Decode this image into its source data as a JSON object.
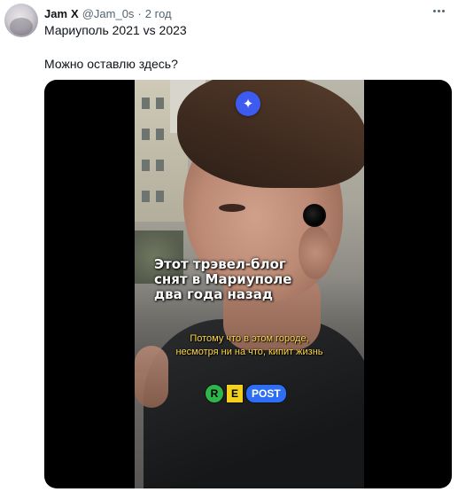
{
  "tweet": {
    "author_name": "Jam",
    "author_badge": "X",
    "handle": "@Jam_0s",
    "separator": "·",
    "time": "2 год",
    "text_line1": "Мариуполь 2021 vs 2023",
    "text_line2": "Можно оставлю здесь?"
  },
  "video": {
    "caption_main": [
      "Этот трэвел-блог",
      "снят в Мариуполе",
      "два года назад"
    ],
    "caption_sub": [
      "Потому что в этом городе,",
      "несмотря ни на что, кипит жизнь"
    ],
    "logo": {
      "r": "R",
      "e": "E",
      "post": "POST"
    },
    "sparkle_glyph": "✦"
  },
  "icons": {
    "more": "more-dots-icon",
    "sparkle": "sparkle-icon"
  },
  "colors": {
    "sparkle_bg": "#3d5af1",
    "caption_sub": "#ffd84a",
    "logo_green": "#2fb54a",
    "logo_yellow": "#f4d11c",
    "logo_blue": "#2d6ef5"
  }
}
